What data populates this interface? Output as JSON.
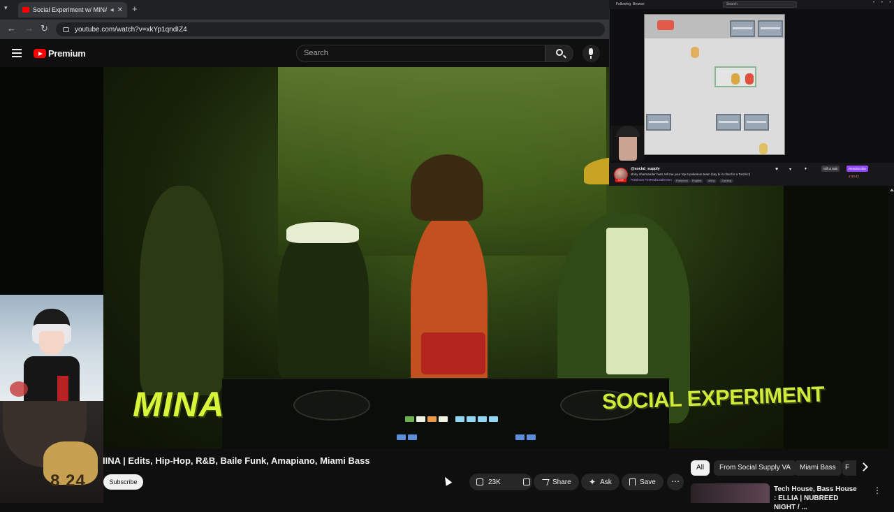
{
  "browser": {
    "tab_title": "Social Experiment w/ MINA",
    "tab_close": "✕",
    "new_tab": "+",
    "url": "youtube.com/watch?v=xkYp1qndIZ4"
  },
  "youtube": {
    "brand": "Premium",
    "search_placeholder": "Search"
  },
  "video": {
    "watermark_left": "MINA",
    "watermark_right": "SOCIAL EXPERIMENT",
    "pillow_text": "8 24",
    "title": "IINA | Edits, Hip-Hop, R&B, Baile Funk, Amapiano, Miami Bass",
    "subscribe_label": "Subscribe",
    "like_count": "23K",
    "share_label": "Share",
    "ask_label": "Ask",
    "save_label": "Save",
    "more_label": "⋯"
  },
  "chips": {
    "items": [
      "All",
      "From Social Supply VA",
      "Miami Bass",
      "F"
    ]
  },
  "recommendation": {
    "title": "Tech House, Bass House : ELLIA | NUBREED NIGHT / ..."
  },
  "stream": {
    "top_left_1": "Following",
    "top_left_2": "Browse",
    "search_placeholder": "Search",
    "channel_name": "@social_supply",
    "stream_title": "shiny charmander hunt, tell me your top 6 pokemon team (say hi in chat for a Torchic!)",
    "game": "Pokémon FireRed/LeafGreen",
    "tags": [
      "Pokemon",
      "English",
      "shiny",
      "Gaming"
    ],
    "gift_label": "Gift a Sub",
    "sub_label": "Resubscribe",
    "stats": "3:30:42",
    "live_label": "LIVE"
  },
  "colors": {
    "youtube_red": "#ff0000",
    "accent_green": "#d8f53a",
    "twitch_purple": "#9147ff",
    "live_red": "#e91916"
  }
}
